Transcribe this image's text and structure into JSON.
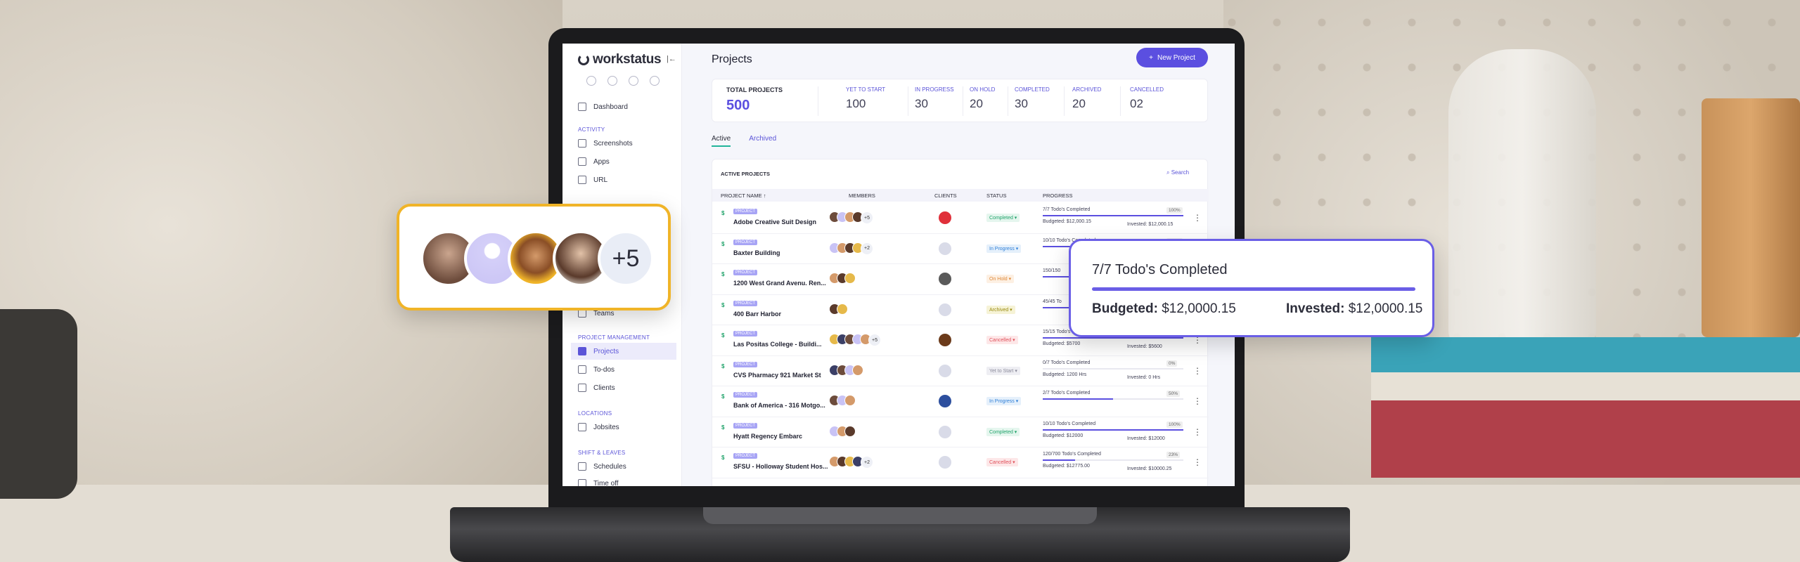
{
  "app": {
    "name": "workstatus"
  },
  "sidebar": {
    "dashboard": "Dashboard",
    "sections": [
      {
        "label": "ACTIVITY",
        "items": [
          "Screenshots",
          "Apps",
          "URL"
        ]
      },
      {
        "label": "PROJECT MANAGEMENT",
        "items": [
          "Projects",
          "To-dos",
          "Clients"
        ]
      },
      {
        "label": "LOCATIONS",
        "items": [
          "Jobsites"
        ]
      },
      {
        "label": "SHIFT & LEAVES",
        "items": [
          "Schedules",
          "Time off"
        ]
      }
    ],
    "teams": "Teams",
    "active_item": "Projects"
  },
  "header": {
    "title": "Projects",
    "new_button": "New Project"
  },
  "stats": {
    "total": {
      "label": "TOTAL PROJECTS",
      "value": "500"
    },
    "items": [
      {
        "label": "YET TO START",
        "value": "100"
      },
      {
        "label": "IN PROGRESS",
        "value": "30"
      },
      {
        "label": "ON HOLD",
        "value": "20"
      },
      {
        "label": "COMPLETED",
        "value": "30"
      },
      {
        "label": "ARCHIVED",
        "value": "20"
      },
      {
        "label": "CANCELLED",
        "value": "02"
      }
    ]
  },
  "tabs": {
    "active": "Active",
    "archived": "Archived"
  },
  "table": {
    "title": "ACTIVE PROJECTS",
    "search": "Search",
    "columns": [
      "PROJECT NAME ↑",
      "MEMBERS",
      "CLIENTS",
      "STATUS",
      "PROGRESS"
    ],
    "tag_label": "PROJECT",
    "rows": [
      {
        "name": "Adobe Creative Suit Design",
        "more": "+5",
        "status": "Completed",
        "todos": "7/7 Todo's Completed",
        "pct": "100%",
        "fill": 1.0,
        "budget": "Budgeted: $12,000.15",
        "invested": "Invested: $12,000.15"
      },
      {
        "name": "Baxter Building",
        "more": "+2",
        "status": "In Progress",
        "todos": "10/10 Todo's Completed",
        "pct": "100%",
        "fill": 1.0,
        "budget": "",
        "invested": ""
      },
      {
        "name": "1200 West Grand Avenu. Ren...",
        "more": "",
        "status": "On Hold",
        "todos": "150/150",
        "pct": "",
        "fill": 1.0,
        "budget": "",
        "invested": ""
      },
      {
        "name": "400 Barr Harbor",
        "more": "",
        "status": "Archived",
        "todos": "45/45 To",
        "pct": "",
        "fill": 1.0,
        "budget": "",
        "invested": ""
      },
      {
        "name": "Las Positas College - Buildi...",
        "more": "+5",
        "status": "Cancelled",
        "todos": "15/15 Todo's Completed",
        "pct": "",
        "fill": 1.0,
        "budget": "Budgeted: $5700",
        "invested": "Invested: $5600"
      },
      {
        "name": "CVS Pharmacy 921 Market St",
        "more": "",
        "status": "Yet to Start",
        "todos": "0/7 Todo's Completed",
        "pct": "0%",
        "fill": 0.0,
        "budget": "Budgeted: 1200 Hrs",
        "invested": "Invested: 0 Hrs"
      },
      {
        "name": "Bank of America - 316 Motgo...",
        "more": "",
        "status": "In Progress",
        "todos": "2/7 Todo's Completed",
        "pct": "50%",
        "fill": 0.5,
        "budget": "",
        "invested": ""
      },
      {
        "name": "Hyatt Regency Embarc",
        "more": "",
        "status": "Completed",
        "todos": "10/10 Todo's Completed",
        "pct": "100%",
        "fill": 1.0,
        "budget": "Budgeted: $12000",
        "invested": "Invested: $12000"
      },
      {
        "name": "SFSU - Holloway Student Hos...",
        "more": "+2",
        "status": "Cancelled",
        "todos": "120/700 Todo's Completed",
        "pct": "23%",
        "fill": 0.23,
        "budget": "Budgeted: $12775.00",
        "invested": "Invested: $10000.25"
      }
    ]
  },
  "callouts": {
    "members_more": "+5",
    "progress": {
      "todos": "7/7 Todo's Completed",
      "budget_label": "Budgeted:",
      "budget_value": "$12,0000.15",
      "invested_label": "Invested:",
      "invested_value": "$12,0000.15"
    }
  },
  "colors": {
    "accent": "#5b4fe0",
    "completed": "#21a36b",
    "in_progress": "#2f7fd8",
    "on_hold": "#e08a3a",
    "cancelled": "#e0505a",
    "callout_members_border": "#f0b428",
    "callout_progress_border": "#6a5ee6"
  }
}
